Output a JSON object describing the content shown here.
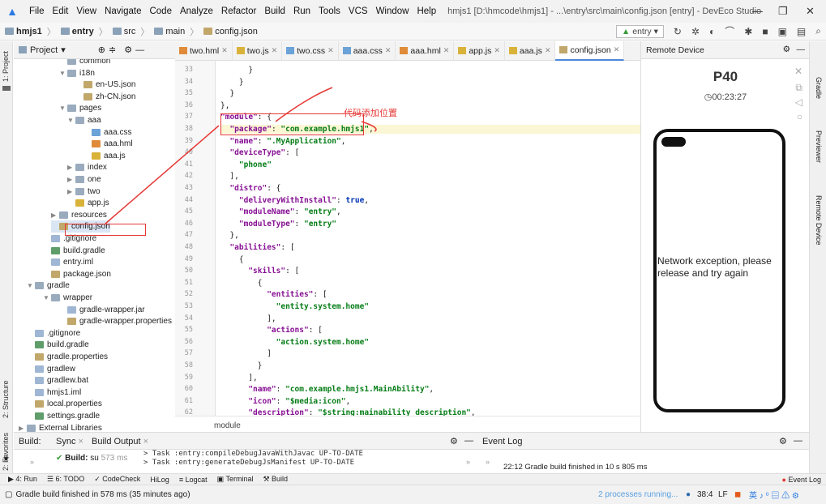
{
  "menu": {
    "items": [
      "File",
      "Edit",
      "View",
      "Navigate",
      "Code",
      "Analyze",
      "Refactor",
      "Build",
      "Run",
      "Tools",
      "VCS",
      "Window",
      "Help"
    ],
    "title": "hmjs1 [D:\\hmcode\\hmjs1] - ...\\entry\\src\\main\\config.json [entry] - DevEco Studio"
  },
  "nav": {
    "crumbs": [
      "hmjs1",
      "entry",
      "src",
      "main",
      "config.json"
    ],
    "run_config": "entry"
  },
  "project": {
    "header": "Project",
    "tree": [
      {
        "label": "common",
        "indent": 5,
        "type": "folder",
        "arrow": ""
      },
      {
        "label": "i18n",
        "indent": 5,
        "type": "folder",
        "arrow": "▼"
      },
      {
        "label": "en-US.json",
        "indent": 7,
        "type": "json",
        "arrow": ""
      },
      {
        "label": "zh-CN.json",
        "indent": 7,
        "type": "json",
        "arrow": ""
      },
      {
        "label": "pages",
        "indent": 5,
        "type": "folder",
        "arrow": "▼"
      },
      {
        "label": "aaa",
        "indent": 6,
        "type": "folder",
        "arrow": "▼"
      },
      {
        "label": "aaa.css",
        "indent": 8,
        "type": "css",
        "arrow": ""
      },
      {
        "label": "aaa.hml",
        "indent": 8,
        "type": "html",
        "arrow": ""
      },
      {
        "label": "aaa.js",
        "indent": 8,
        "type": "js",
        "arrow": ""
      },
      {
        "label": "index",
        "indent": 6,
        "type": "folder",
        "arrow": "▶"
      },
      {
        "label": "one",
        "indent": 6,
        "type": "folder",
        "arrow": "▶"
      },
      {
        "label": "two",
        "indent": 6,
        "type": "folder",
        "arrow": "▶"
      },
      {
        "label": "app.js",
        "indent": 6,
        "type": "js",
        "arrow": ""
      },
      {
        "label": "resources",
        "indent": 4,
        "type": "folder",
        "arrow": "▶"
      },
      {
        "label": "config.json",
        "indent": 4,
        "type": "json",
        "arrow": "",
        "selected": true
      },
      {
        "label": ".gitignore",
        "indent": 3,
        "type": "file",
        "arrow": ""
      },
      {
        "label": "build.gradle",
        "indent": 3,
        "type": "gradle",
        "arrow": ""
      },
      {
        "label": "entry.iml",
        "indent": 3,
        "type": "file",
        "arrow": ""
      },
      {
        "label": "package.json",
        "indent": 3,
        "type": "json",
        "arrow": ""
      },
      {
        "label": "gradle",
        "indent": 1,
        "type": "folder",
        "arrow": "▼"
      },
      {
        "label": "wrapper",
        "indent": 3,
        "type": "folder",
        "arrow": "▼"
      },
      {
        "label": "gradle-wrapper.jar",
        "indent": 5,
        "type": "file",
        "arrow": ""
      },
      {
        "label": "gradle-wrapper.properties",
        "indent": 5,
        "type": "json",
        "arrow": ""
      },
      {
        "label": ".gitignore",
        "indent": 1,
        "type": "file",
        "arrow": ""
      },
      {
        "label": "build.gradle",
        "indent": 1,
        "type": "gradle",
        "arrow": ""
      },
      {
        "label": "gradle.properties",
        "indent": 1,
        "type": "json",
        "arrow": ""
      },
      {
        "label": "gradlew",
        "indent": 1,
        "type": "file",
        "arrow": ""
      },
      {
        "label": "gradlew.bat",
        "indent": 1,
        "type": "file",
        "arrow": ""
      },
      {
        "label": "hmjs1.iml",
        "indent": 1,
        "type": "file",
        "arrow": ""
      },
      {
        "label": "local.properties",
        "indent": 1,
        "type": "json",
        "arrow": ""
      },
      {
        "label": "settings.gradle",
        "indent": 1,
        "type": "gradle",
        "arrow": ""
      },
      {
        "label": "External Libraries",
        "indent": 0,
        "type": "folder",
        "arrow": "▶"
      }
    ]
  },
  "tabs": [
    {
      "label": "two.hml",
      "type": "html"
    },
    {
      "label": "two.js",
      "type": "js"
    },
    {
      "label": "two.css",
      "type": "css"
    },
    {
      "label": "aaa.css",
      "type": "css"
    },
    {
      "label": "aaa.hml",
      "type": "html"
    },
    {
      "label": "app.js",
      "type": "js"
    },
    {
      "label": "aaa.js",
      "type": "js"
    },
    {
      "label": "config.json",
      "type": "json",
      "active": true
    }
  ],
  "code": {
    "first_line": 33,
    "lines": [
      "      }",
      "    }",
      "  }",
      "},",
      "\"module\": {",
      "  \"package\": \"com.example.hmjs1\",",
      "  \"name\": \".MyApplication\",",
      "  \"deviceType\": [",
      "    \"phone\"",
      "  ],",
      "  \"distro\": {",
      "    \"deliveryWithInstall\": true,",
      "    \"moduleName\": \"entry\",",
      "    \"moduleType\": \"entry\"",
      "  },",
      "  \"abilities\": [",
      "    {",
      "      \"skills\": [",
      "        {",
      "          \"entities\": [",
      "            \"entity.system.home\"",
      "          ],",
      "          \"actions\": [",
      "            \"action.system.home\"",
      "          ]",
      "        }",
      "      ],",
      "      \"name\": \"com.example.hmjs1.MainAbility\",",
      "      \"icon\": \"$media:icon\",",
      "      \"description\": \"$string:mainability_description\","
    ],
    "breadcrumb": "module",
    "annotation": "代码添加位置"
  },
  "remote": {
    "header": "Remote Device",
    "device": "P40",
    "timer": "00:23:27",
    "message": "Network exception, please release and try again"
  },
  "build": {
    "tab_build": "Build:",
    "tab_sync": "Sync",
    "tab_output": "Build Output",
    "item": "Build:",
    "item_detail": "su",
    "item_time": "573 ms",
    "log1": "> Task :entry:compileDebugJavaWithJavac UP-TO-DATE",
    "log2": "> Task :entry:generateDebugJsManifest UP-TO-DATE",
    "event_header": "Event Log",
    "event_line": "22:12  Gradle build finished in 10 s 805 ms"
  },
  "bottom_tools": [
    "4: Run",
    "6: TODO",
    "CodeCheck",
    "HiLog",
    "Logcat",
    "Terminal",
    "Build"
  ],
  "bottom_event": "Event Log",
  "status": {
    "left": "Gradle build finished in 578 ms (35 minutes ago)",
    "processes": "2 processes running...",
    "pos": "38:4",
    "le": "LF"
  },
  "side_left": [
    "1: Project",
    "2: Structure",
    "2: Favorites"
  ],
  "side_right": [
    "Gradle",
    "Previewer",
    "Remote Device"
  ],
  "colors": {
    "accent": "#4a88d8",
    "annotation": "#e53935",
    "keyword": "#871094",
    "string": "#067d17"
  }
}
